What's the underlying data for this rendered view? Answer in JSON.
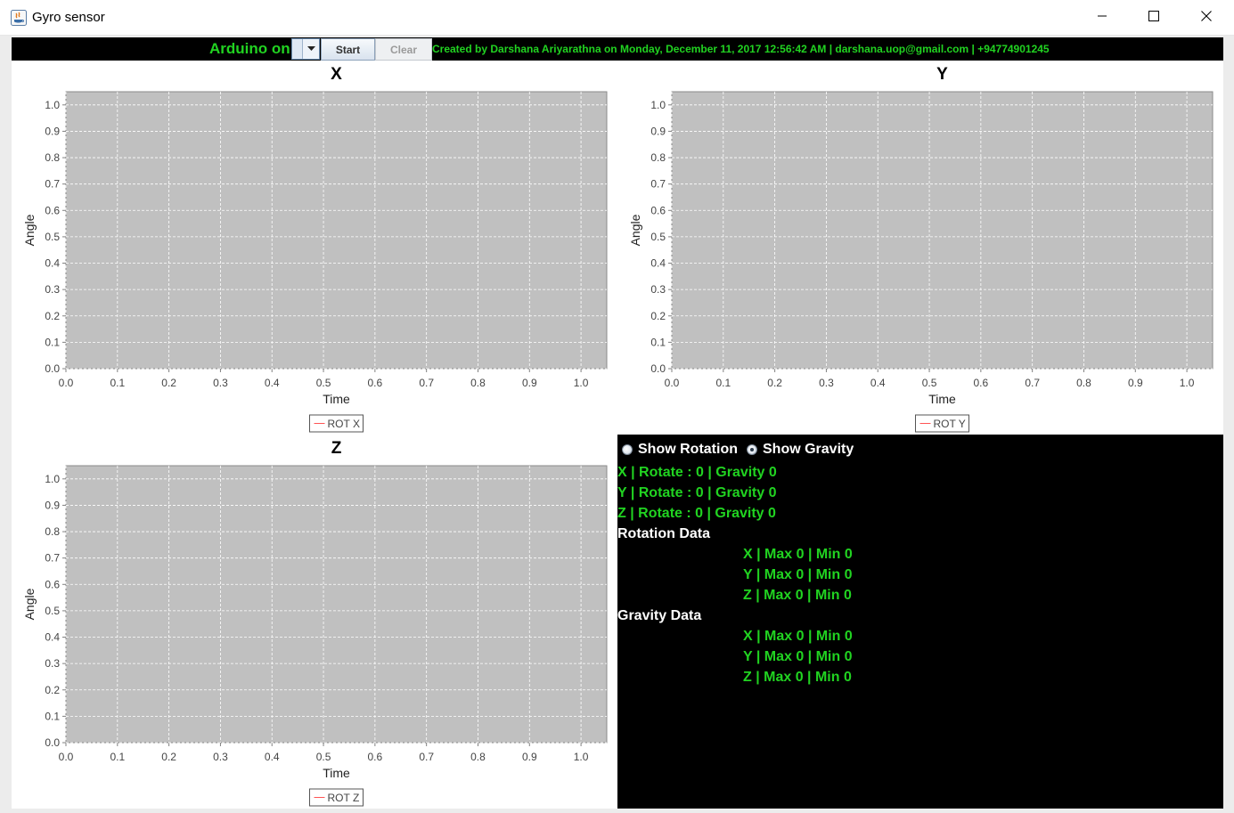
{
  "window": {
    "title": "Gyro sensor",
    "minimize_icon": "minimize-icon",
    "maximize_icon": "maximize-icon",
    "close_icon": "close-icon"
  },
  "toolbar": {
    "status_label": "Arduino on",
    "port_select_value": "",
    "start_label": "Start",
    "clear_label": "Clear",
    "credits": "Created by Darshana Ariyarathna on Monday, December 11, 2017 12:56:42 AM | darshana.uop@gmail.com | +94774901245"
  },
  "colors": {
    "accent_green": "#21d321",
    "plot_background": "#c0c0c0",
    "series_line": "#ff5555"
  },
  "chart_data": [
    {
      "type": "line",
      "title": "X",
      "xlabel": "Time",
      "ylabel": "Angle",
      "xlim": [
        0.0,
        1.05
      ],
      "ylim": [
        0.0,
        1.05
      ],
      "xticks": [
        "0.0",
        "0.1",
        "0.2",
        "0.3",
        "0.4",
        "0.5",
        "0.6",
        "0.7",
        "0.8",
        "0.9",
        "1.0"
      ],
      "yticks": [
        "0.0",
        "0.1",
        "0.2",
        "0.3",
        "0.4",
        "0.5",
        "0.6",
        "0.7",
        "0.8",
        "0.9",
        "1.0"
      ],
      "grid": true,
      "legend_position": "bottom",
      "series": [
        {
          "name": "ROT X",
          "x": [],
          "y": []
        }
      ]
    },
    {
      "type": "line",
      "title": "Y",
      "xlabel": "Time",
      "ylabel": "Angle",
      "xlim": [
        0.0,
        1.05
      ],
      "ylim": [
        0.0,
        1.05
      ],
      "xticks": [
        "0.0",
        "0.1",
        "0.2",
        "0.3",
        "0.4",
        "0.5",
        "0.6",
        "0.7",
        "0.8",
        "0.9",
        "1.0"
      ],
      "yticks": [
        "0.0",
        "0.1",
        "0.2",
        "0.3",
        "0.4",
        "0.5",
        "0.6",
        "0.7",
        "0.8",
        "0.9",
        "1.0"
      ],
      "grid": true,
      "legend_position": "bottom",
      "series": [
        {
          "name": "ROT Y",
          "x": [],
          "y": []
        }
      ]
    },
    {
      "type": "line",
      "title": "Z",
      "xlabel": "Time",
      "ylabel": "Angle",
      "xlim": [
        0.0,
        1.05
      ],
      "ylim": [
        0.0,
        1.05
      ],
      "xticks": [
        "0.0",
        "0.1",
        "0.2",
        "0.3",
        "0.4",
        "0.5",
        "0.6",
        "0.7",
        "0.8",
        "0.9",
        "1.0"
      ],
      "yticks": [
        "0.0",
        "0.1",
        "0.2",
        "0.3",
        "0.4",
        "0.5",
        "0.6",
        "0.7",
        "0.8",
        "0.9",
        "1.0"
      ],
      "grid": true,
      "legend_position": "bottom",
      "series": [
        {
          "name": "ROT Z",
          "x": [],
          "y": []
        }
      ]
    }
  ],
  "info": {
    "show_rotation_label": "Show Rotation",
    "show_gravity_label": "Show Gravity",
    "selected_option": "Show Gravity",
    "x_line": "X | Rotate : 0 | Gravity 0",
    "y_line": "Y | Rotate : 0 | Gravity 0",
    "z_line": "Z | Rotate : 0 | Gravity 0",
    "rotation_header": "Rotation Data",
    "rotation": {
      "x": "X | Max 0 | Min 0",
      "y": "Y | Max 0 | Min 0",
      "z": "Z | Max 0 | Min 0"
    },
    "gravity_header": "Gravity Data",
    "gravity": {
      "x": "X | Max 0 | Min 0",
      "y": "Y | Max 0 | Min 0",
      "z": "Z | Max 0 | Min 0"
    }
  }
}
